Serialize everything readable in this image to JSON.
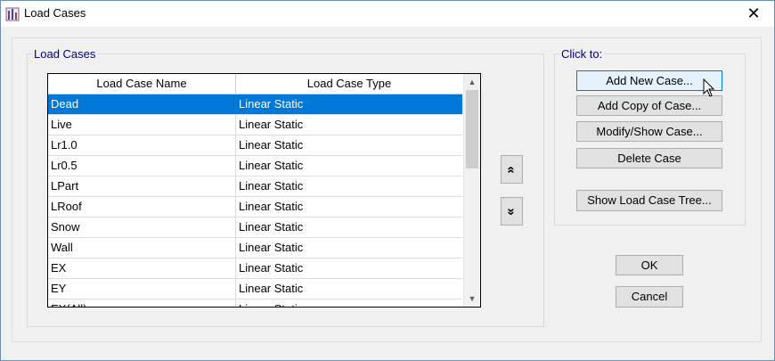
{
  "window": {
    "title": "Load Cases",
    "close_glyph": "✕"
  },
  "load_cases_group": {
    "label": "Load Cases"
  },
  "table": {
    "headers": [
      "Load Case Name",
      "Load Case Type"
    ],
    "rows": [
      {
        "name": "Dead",
        "type": "Linear Static",
        "selected": true
      },
      {
        "name": "Live",
        "type": "Linear Static"
      },
      {
        "name": "Lr1.0",
        "type": "Linear Static"
      },
      {
        "name": "Lr0.5",
        "type": "Linear Static"
      },
      {
        "name": "LPart",
        "type": "Linear Static"
      },
      {
        "name": "LRoof",
        "type": "Linear Static"
      },
      {
        "name": "Snow",
        "type": "Linear Static"
      },
      {
        "name": "Wall",
        "type": "Linear Static"
      },
      {
        "name": "EX",
        "type": "Linear Static"
      },
      {
        "name": "EY",
        "type": "Linear Static"
      },
      {
        "name": "EX(All)",
        "type": "Linear Static"
      }
    ],
    "scroll_up_glyph": "▲",
    "scroll_down_glyph": "▼"
  },
  "move_buttons": {
    "up_glyph": "«",
    "down_glyph": "»"
  },
  "click_to_group": {
    "label": "Click to:",
    "buttons": [
      "Add New Case...",
      "Add Copy of Case...",
      "Modify/Show Case...",
      "Delete Case",
      "Show Load Case Tree..."
    ]
  },
  "dialog_buttons": {
    "ok": "OK",
    "cancel": "Cancel"
  },
  "colors": {
    "selection": "#0078d7",
    "group_label": "#000080",
    "focus_border": "#0078d7"
  }
}
